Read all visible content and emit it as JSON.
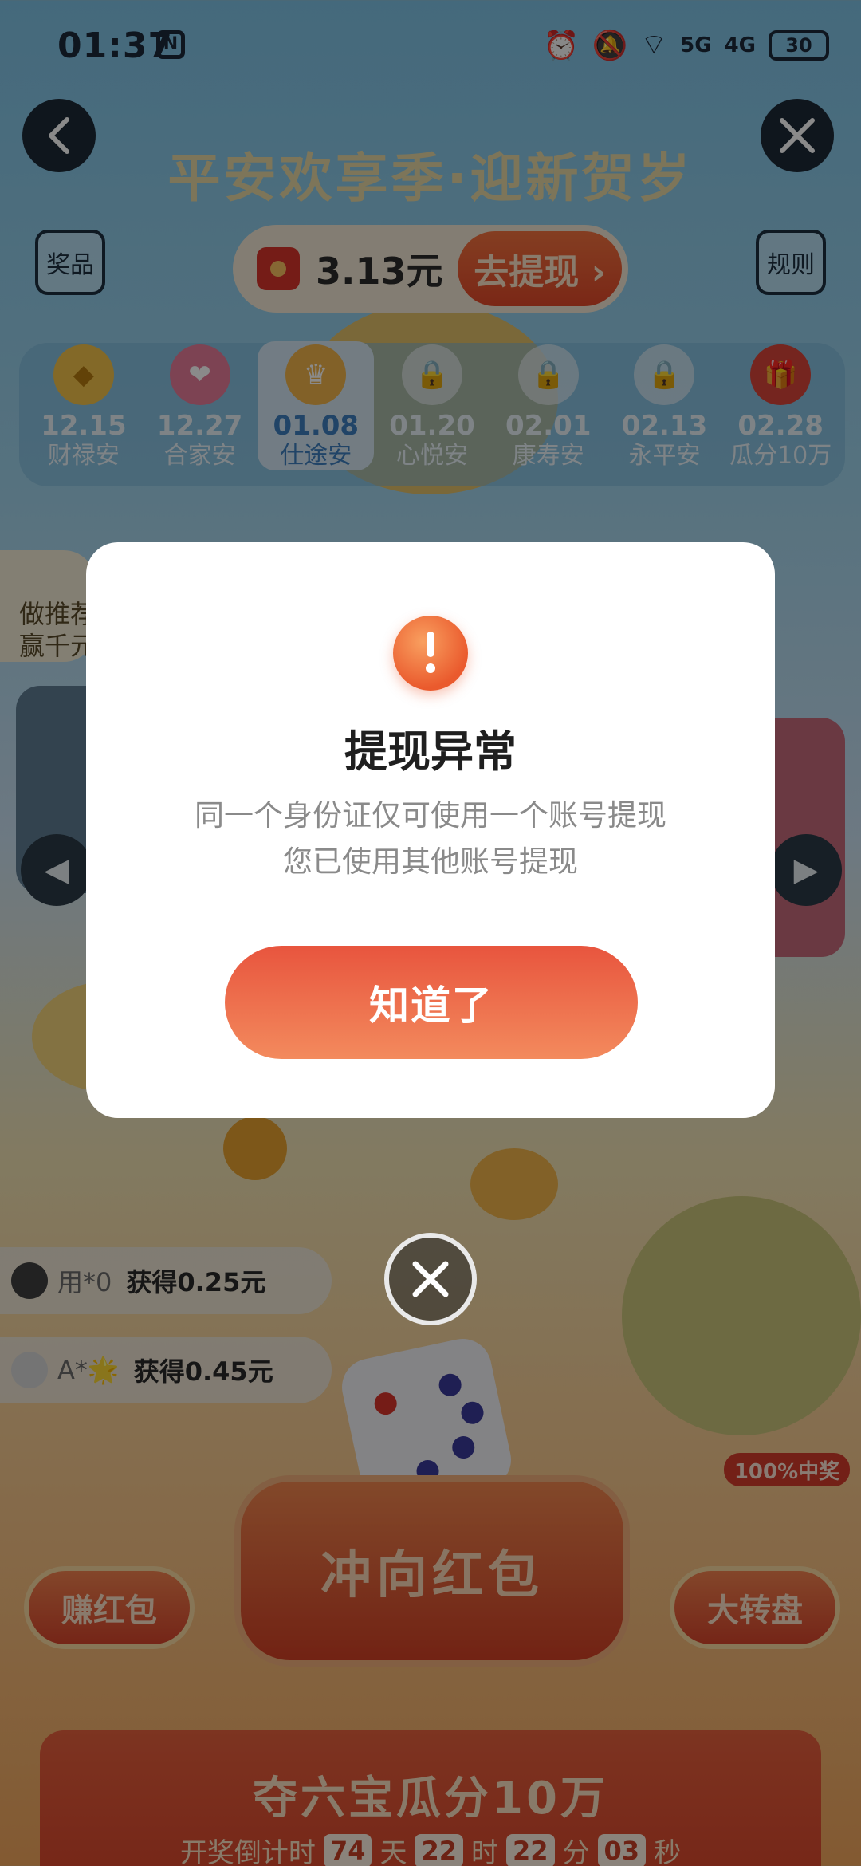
{
  "status_bar": {
    "time": "01:37",
    "nfc": "N",
    "battery": "30",
    "signal_1": "5G",
    "signal_2": "4G"
  },
  "header": {
    "title": "平安欢享季·迎新贺岁"
  },
  "top_actions": {
    "prizes_label": "奖品",
    "rules_label": "规则",
    "cash_amount": "3.13元",
    "withdraw_label": "去提现 ›"
  },
  "date_tabs": [
    {
      "date": "12.15",
      "name": "财禄安"
    },
    {
      "date": "12.27",
      "name": "合家安"
    },
    {
      "date": "01.08",
      "name": "仕途安"
    },
    {
      "date": "01.20",
      "name": "心悦安"
    },
    {
      "date": "02.01",
      "name": "康寿安"
    },
    {
      "date": "02.13",
      "name": "永平安"
    },
    {
      "date": "02.28",
      "name": "瓜分10万"
    }
  ],
  "side_promo": {
    "line1": "做推荐",
    "line2": "赢千元"
  },
  "feed": [
    {
      "user": "用*0",
      "gain": "获得0.25元"
    },
    {
      "user": "A*🌟",
      "gain": "获得0.45元"
    }
  ],
  "game": {
    "main_label": "冲向红包",
    "left_label": "赚红包",
    "right_label": "大转盘",
    "badge": "100%中奖"
  },
  "bottom": {
    "title": "夺六宝瓜分10万",
    "countdown_label": "开奖倒计时",
    "days": "74",
    "days_unit": "天",
    "hours": "22",
    "hours_unit": "时",
    "minutes": "22",
    "minutes_unit": "分",
    "seconds": "03",
    "seconds_unit": "秒"
  },
  "modal": {
    "title": "提现异常",
    "message_line1": "同一个身份证仅可使用一个账号提现",
    "message_line2": "您已使用其他账号提现",
    "confirm_label": "知道了"
  },
  "colors": {
    "accent": "#e8553e",
    "accent_light": "#f38a5d",
    "overlay": "rgba(0,0,0,0.46)"
  }
}
